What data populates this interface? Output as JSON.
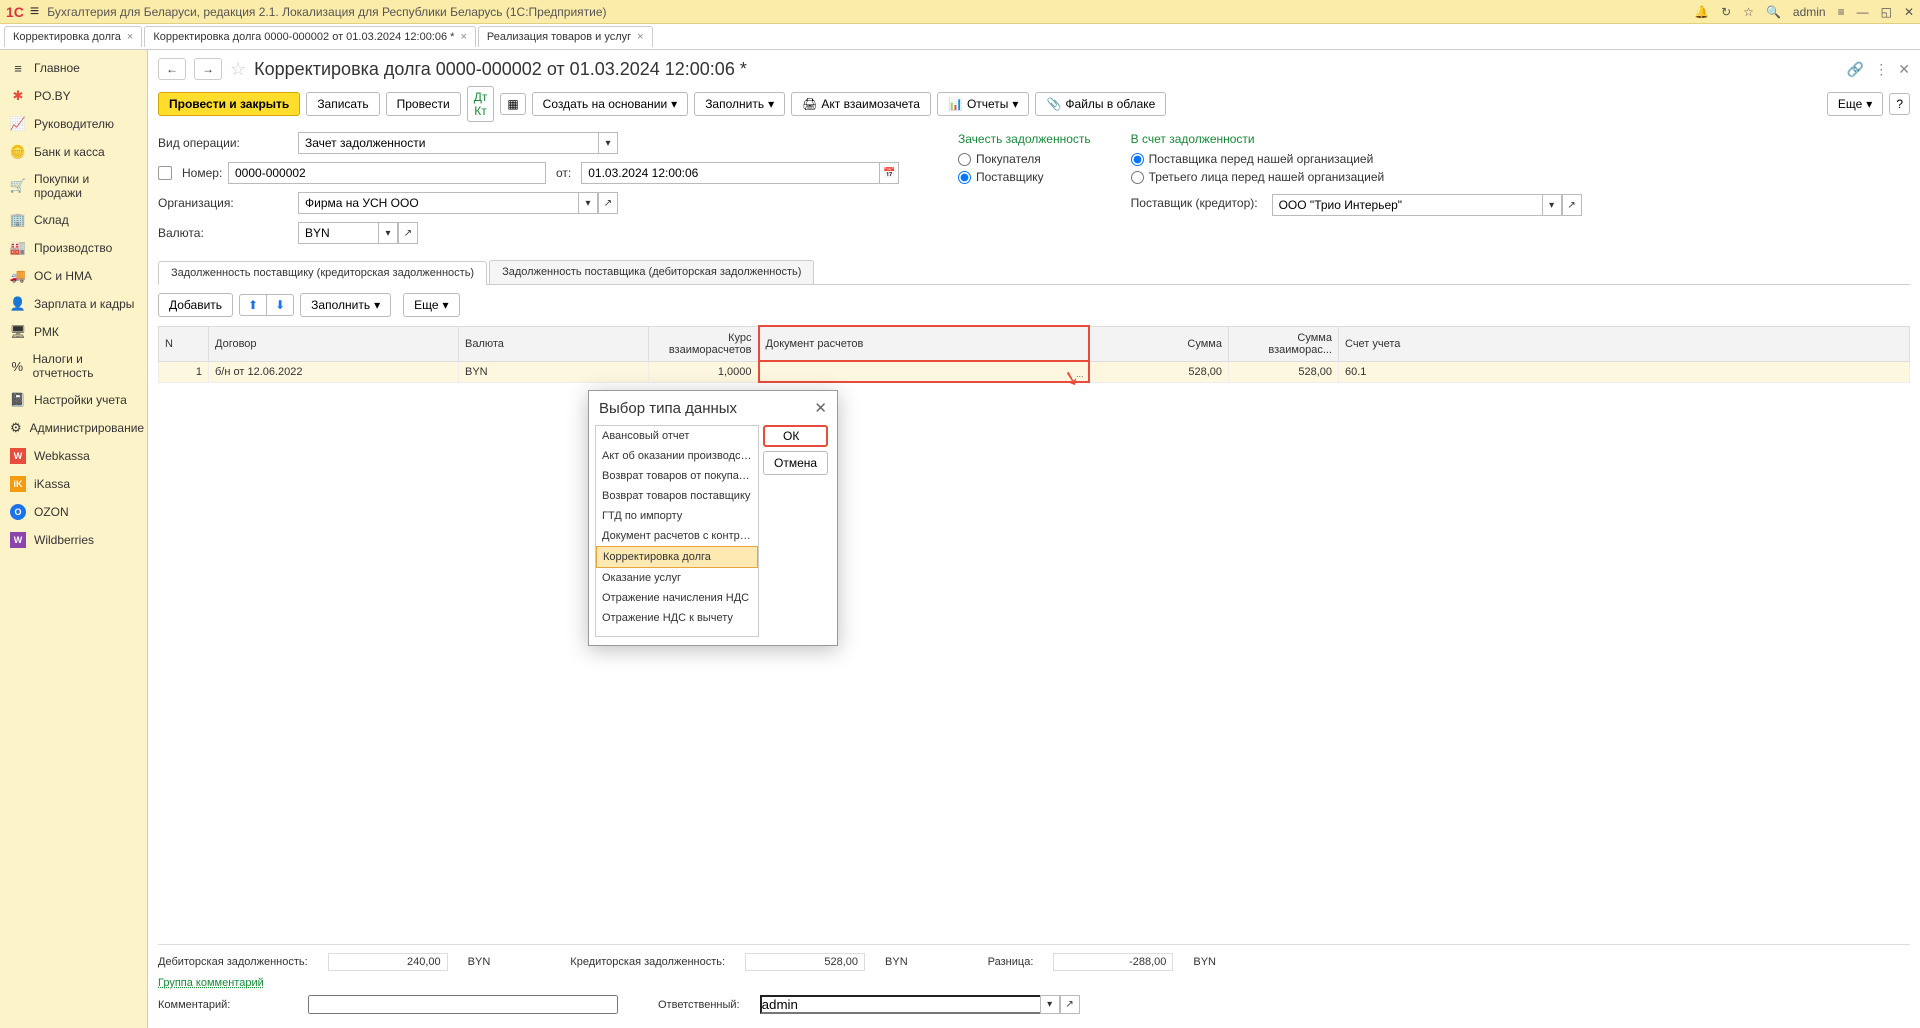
{
  "titlebar": {
    "logo": "1C",
    "title": "Бухгалтерия для Беларуси, редакция 2.1. Локализация для Республики Беларусь   (1С:Предприятие)",
    "user": "admin"
  },
  "tabs": [
    {
      "label": "Корректировка долга"
    },
    {
      "label": "Корректировка долга 0000-000002 от 01.03.2024 12:00:06 *",
      "active": true
    },
    {
      "label": "Реализация товаров и услуг"
    }
  ],
  "sidebar": [
    {
      "icon": "≡",
      "label": "Главное",
      "color": "#333"
    },
    {
      "icon": "✱",
      "label": "PO.BY",
      "color": "#e74c3c"
    },
    {
      "icon": "📈",
      "label": "Руководителю",
      "color": "#333"
    },
    {
      "icon": "🪙",
      "label": "Банк и касса",
      "color": "#333"
    },
    {
      "icon": "🛒",
      "label": "Покупки и продажи",
      "color": "#333"
    },
    {
      "icon": "🏢",
      "label": "Склад",
      "color": "#333"
    },
    {
      "icon": "🏭",
      "label": "Производство",
      "color": "#333"
    },
    {
      "icon": "🚚",
      "label": "ОС и НМА",
      "color": "#333"
    },
    {
      "icon": "👤",
      "label": "Зарплата и кадры",
      "color": "#333"
    },
    {
      "icon": "🖥",
      "label": "РМК",
      "color": "#333"
    },
    {
      "icon": "%",
      "label": "Налоги и отчетность",
      "color": "#333"
    },
    {
      "icon": "📓",
      "label": "Настройки учета",
      "color": "#333"
    },
    {
      "icon": "⚙",
      "label": "Администрирование",
      "color": "#333"
    },
    {
      "icon": "W",
      "label": "Webkassa",
      "color": "#e74c3c"
    },
    {
      "icon": "iK",
      "label": "iKassa",
      "color": "#f39c12"
    },
    {
      "icon": "O",
      "label": "OZON",
      "color": "#1a73e8"
    },
    {
      "icon": "W",
      "label": "Wildberries",
      "color": "#8e44ad"
    }
  ],
  "doc": {
    "title": "Корректировка долга 0000-000002 от 01.03.2024 12:00:06 *",
    "toolbar": {
      "post_close": "Провести и закрыть",
      "save": "Записать",
      "post": "Провести",
      "create_based": "Создать на основании",
      "fill": "Заполнить",
      "act": "Акт взаимозачета",
      "reports": "Отчеты",
      "files": "Файлы в облаке",
      "more": "Еще"
    },
    "labels": {
      "op_type": "Вид операции:",
      "number": "Номер:",
      "from": "от:",
      "org": "Организация:",
      "currency": "Валюта:",
      "supplier": "Поставщик (кредитор):"
    },
    "values": {
      "op_type": "Зачет задолженности",
      "number": "0000-000002",
      "date": "01.03.2024 12:00:06",
      "org": "Фирма на УСН ООО",
      "currency": "BYN",
      "supplier": "ООО \"Трио Интерьер\""
    },
    "radio": {
      "left_h": "Зачесть задолженность",
      "left_1": "Покупателя",
      "left_2": "Поставщику",
      "right_h": "В счет задолженности",
      "right_1": "Поставщика перед нашей организацией",
      "right_2": "Третьего лица перед нашей организацией"
    },
    "subtabs": {
      "t1": "Задолженность поставщику (кредиторская задолженность)",
      "t2": "Задолженность поставщика (дебиторская задолженность)"
    },
    "grid_toolbar": {
      "add": "Добавить",
      "fill": "Заполнить",
      "more": "Еще"
    },
    "grid": {
      "headers": {
        "n": "N",
        "contract": "Договор",
        "currency": "Валюта",
        "rate": "Курс взаиморасчетов",
        "doc": "Документ расчетов",
        "sum": "Сумма",
        "sum2": "Сумма взаиморас...",
        "acc": "Счет учета"
      },
      "row": {
        "n": "1",
        "contract": "б/н от 12.06.2022",
        "currency": "BYN",
        "rate": "1,0000",
        "doc": "",
        "sum": "528,00",
        "sum2": "528,00",
        "acc": "60.1"
      }
    },
    "footer": {
      "debit_l": "Дебиторская задолженность:",
      "debit_v": "240,00",
      "byn": "BYN",
      "credit_l": "Кредиторская задолженность:",
      "credit_v": "528,00",
      "diff_l": "Разница:",
      "diff_v": "-288,00",
      "comments_group": "Группа комментарий",
      "comment_l": "Комментарий:",
      "resp_l": "Ответственный:",
      "resp_v": "admin"
    }
  },
  "modal": {
    "title": "Выбор типа данных",
    "ok": "ОК",
    "cancel": "Отмена",
    "options": [
      "Авансовый отчет",
      "Акт об оказании производств...",
      "Возврат товаров от покупателя",
      "Возврат товаров поставщику",
      "ГТД по импорту",
      "Документ расчетов с контраг...",
      "Корректировка долга",
      "Оказание услуг",
      "Отражение начисления НДС",
      "Отражение НДС к вычету"
    ],
    "selected_index": 6
  }
}
